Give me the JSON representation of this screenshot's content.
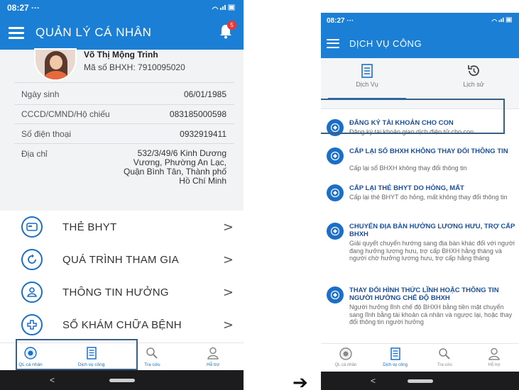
{
  "left": {
    "status_time": "08:27",
    "status_dots": "···",
    "app_title": "QUẢN LÝ CÁ NHÂN",
    "notification_count": "5",
    "profile": {
      "name": "Võ Thị Mộng Trinh",
      "bhxh": "Mã số BHXH: 7910095020"
    },
    "info": [
      {
        "label": "Ngày sinh",
        "value": "06/01/1985"
      },
      {
        "label": "CCCD/CMND/Hộ chiếu",
        "value": "083185000598"
      },
      {
        "label": "Số điện thoại",
        "value": "0932919411"
      },
      {
        "label": "Địa chỉ",
        "value_lines": [
          "532/3/49/6 Kinh Dương",
          "Vương, Phường An Lạc,",
          "Quận Bình Tân, Thành phố",
          "Hồ Chí Minh"
        ]
      }
    ],
    "menu": [
      {
        "label": "THẺ BHYT",
        "icon": "card-icon"
      },
      {
        "label": "QUÁ TRÌNH THAM GIA",
        "icon": "refresh-icon"
      },
      {
        "label": "THÔNG TIN HƯỞNG",
        "icon": "people-icon"
      },
      {
        "label": "SỔ KHÁM CHỮA BỆNH",
        "icon": "medical-cross-icon"
      }
    ],
    "bottom_nav": [
      "QL cá nhân",
      "Dịch vụ công",
      "Tra cứu",
      "Hỗ trợ"
    ]
  },
  "right": {
    "status_time": "08:27",
    "status_dots": "···",
    "app_title": "DỊCH VỤ CÔNG",
    "tabs": [
      "Dịch Vụ",
      "Lịch sử"
    ],
    "services": [
      {
        "title": "ĐĂNG KÝ TÀI KHOẢN CHO CON",
        "desc": "Đăng ký tài khoản giao dịch điện tử cho con"
      },
      {
        "title": "CẤP LẠI SỐ BHXH KHÔNG THAY ĐỔI THÔNG TIN",
        "desc": "Cấp lại sổ BHXH không thay đổi thông tin"
      },
      {
        "title": "CẤP LẠI THẺ BHYT DO HỎNG, MẤT",
        "desc": "Cấp lại thẻ BHYT do hỏng, mất không thay đổi thông tin"
      },
      {
        "title": "CHUYỂN ĐỊA BÀN HƯỞNG LƯƠNG HƯU, TRỢ CẤP BHXH",
        "desc": "Giải quyết chuyển hướng sang địa bàn khác đối với người đang hưởng lương hưu, trợ cấp BHXH hằng tháng và người chờ hưởng lương hưu, trợ cấp hằng tháng"
      },
      {
        "title": "THAY ĐỔI HÌNH THỨC LĨNH HOẶC THÔNG TIN NGƯỜI HƯỞNG CHẾ ĐỘ BHXH",
        "desc": "Người hưởng lĩnh chế độ BHXH bằng tiền mặt chuyển sang lĩnh bằng tài khoản cá nhân và ngược lại, hoặc thay đổi thông tin người hưởng"
      }
    ],
    "bottom_nav": [
      "QL cá nhân",
      "Dịch vụ công",
      "Tra cứu",
      "Hỗ trợ"
    ]
  },
  "colors": {
    "primary": "#1b7fd6",
    "accent": "#1b6fc7",
    "badge": "#e53935",
    "highlight": "#3a5f86"
  },
  "arrow_glyph": "➔"
}
